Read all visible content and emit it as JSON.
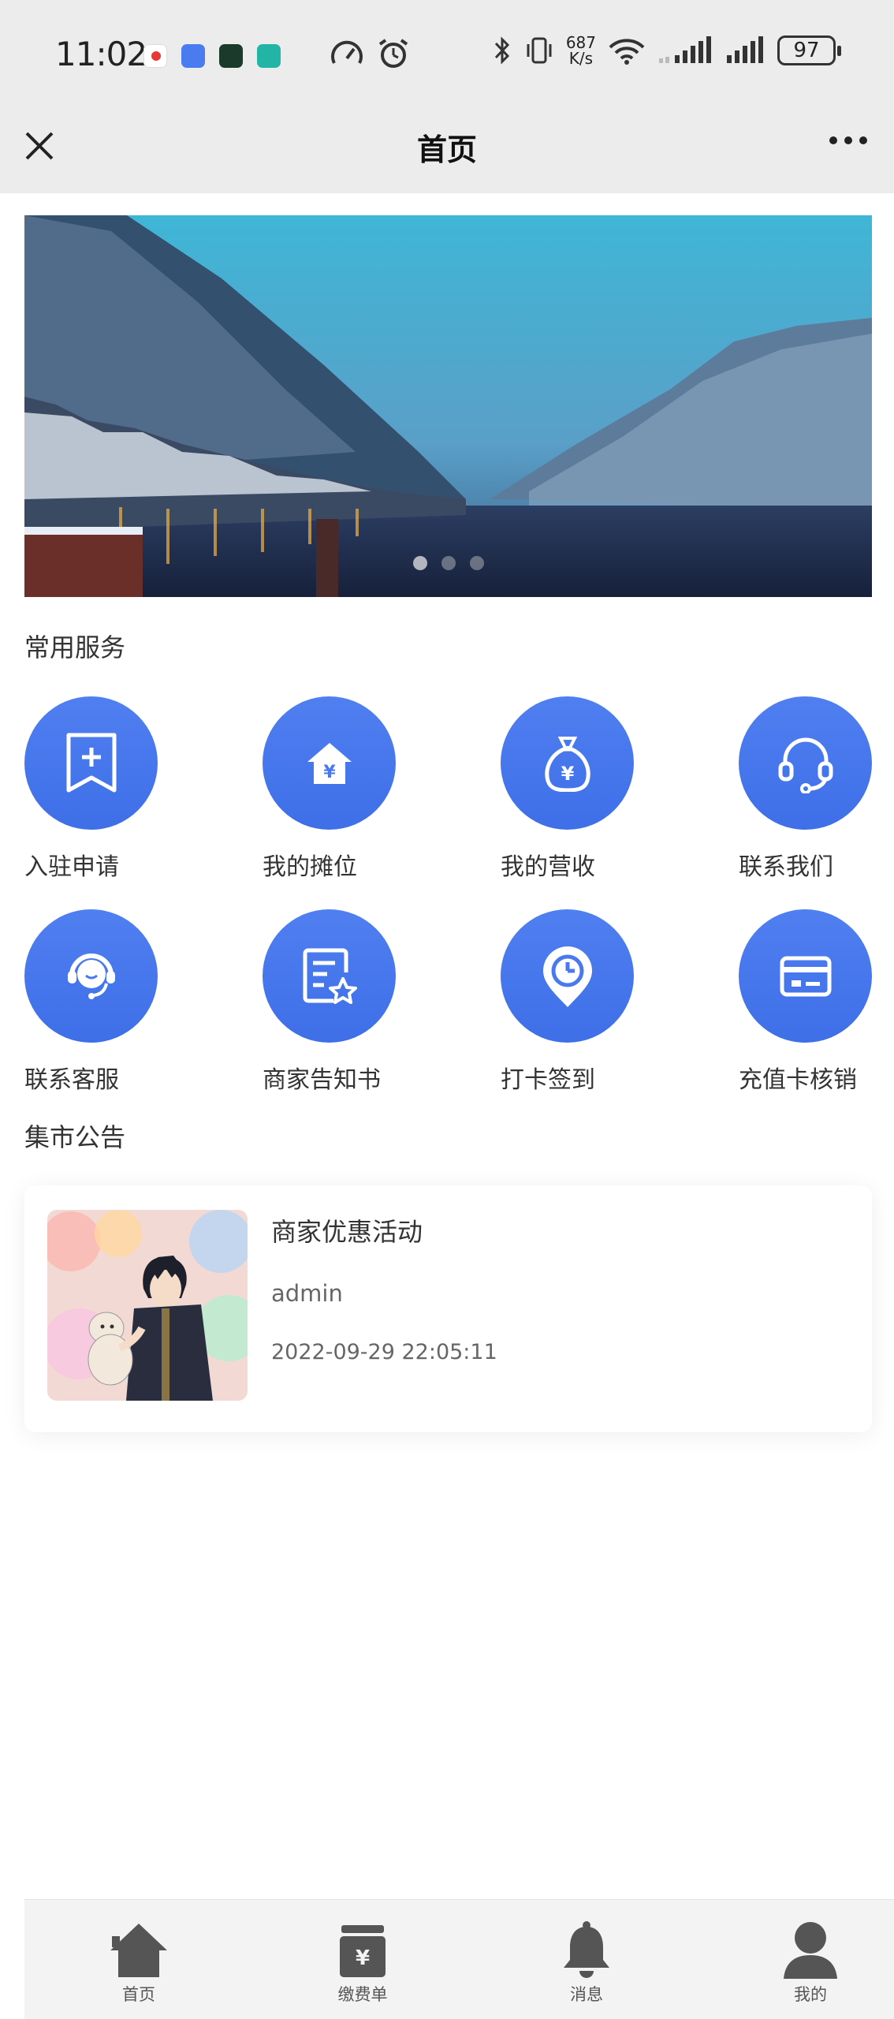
{
  "status_bar": {
    "time": "11:02",
    "net_speed_value": "687",
    "net_speed_unit": "K/s",
    "battery": "97"
  },
  "header": {
    "title": "首页",
    "close_icon": "close-icon",
    "more_icon": "more-icon"
  },
  "banner": {
    "slides": 3,
    "active_index": 0
  },
  "services_section": {
    "title": "常用服务",
    "items": [
      {
        "label": "入驻申请",
        "icon": "bookmark-plus-icon"
      },
      {
        "label": "我的摊位",
        "icon": "house-yen-icon"
      },
      {
        "label": "我的营收",
        "icon": "money-bag-icon"
      },
      {
        "label": "联系我们",
        "icon": "headset-icon"
      },
      {
        "label": "联系客服",
        "icon": "customer-service-icon"
      },
      {
        "label": "商家告知书",
        "icon": "document-star-icon"
      },
      {
        "label": "打卡签到",
        "icon": "clock-pin-icon"
      },
      {
        "label": "充值卡核销",
        "icon": "card-icon"
      }
    ]
  },
  "notice_section": {
    "title": "集市公告",
    "items": [
      {
        "title": "商家优惠活动",
        "author": "admin",
        "time": "2022-09-29  22:05:11"
      }
    ]
  },
  "tabbar": {
    "items": [
      {
        "label": "首页",
        "icon": "home-icon"
      },
      {
        "label": "缴费单",
        "icon": "bill-icon"
      },
      {
        "label": "消息",
        "icon": "bell-icon"
      },
      {
        "label": "我的",
        "icon": "user-icon"
      }
    ]
  },
  "colors": {
    "accent": "#4a78ee",
    "tab_icon": "#555555",
    "header_bg": "#ececec"
  }
}
